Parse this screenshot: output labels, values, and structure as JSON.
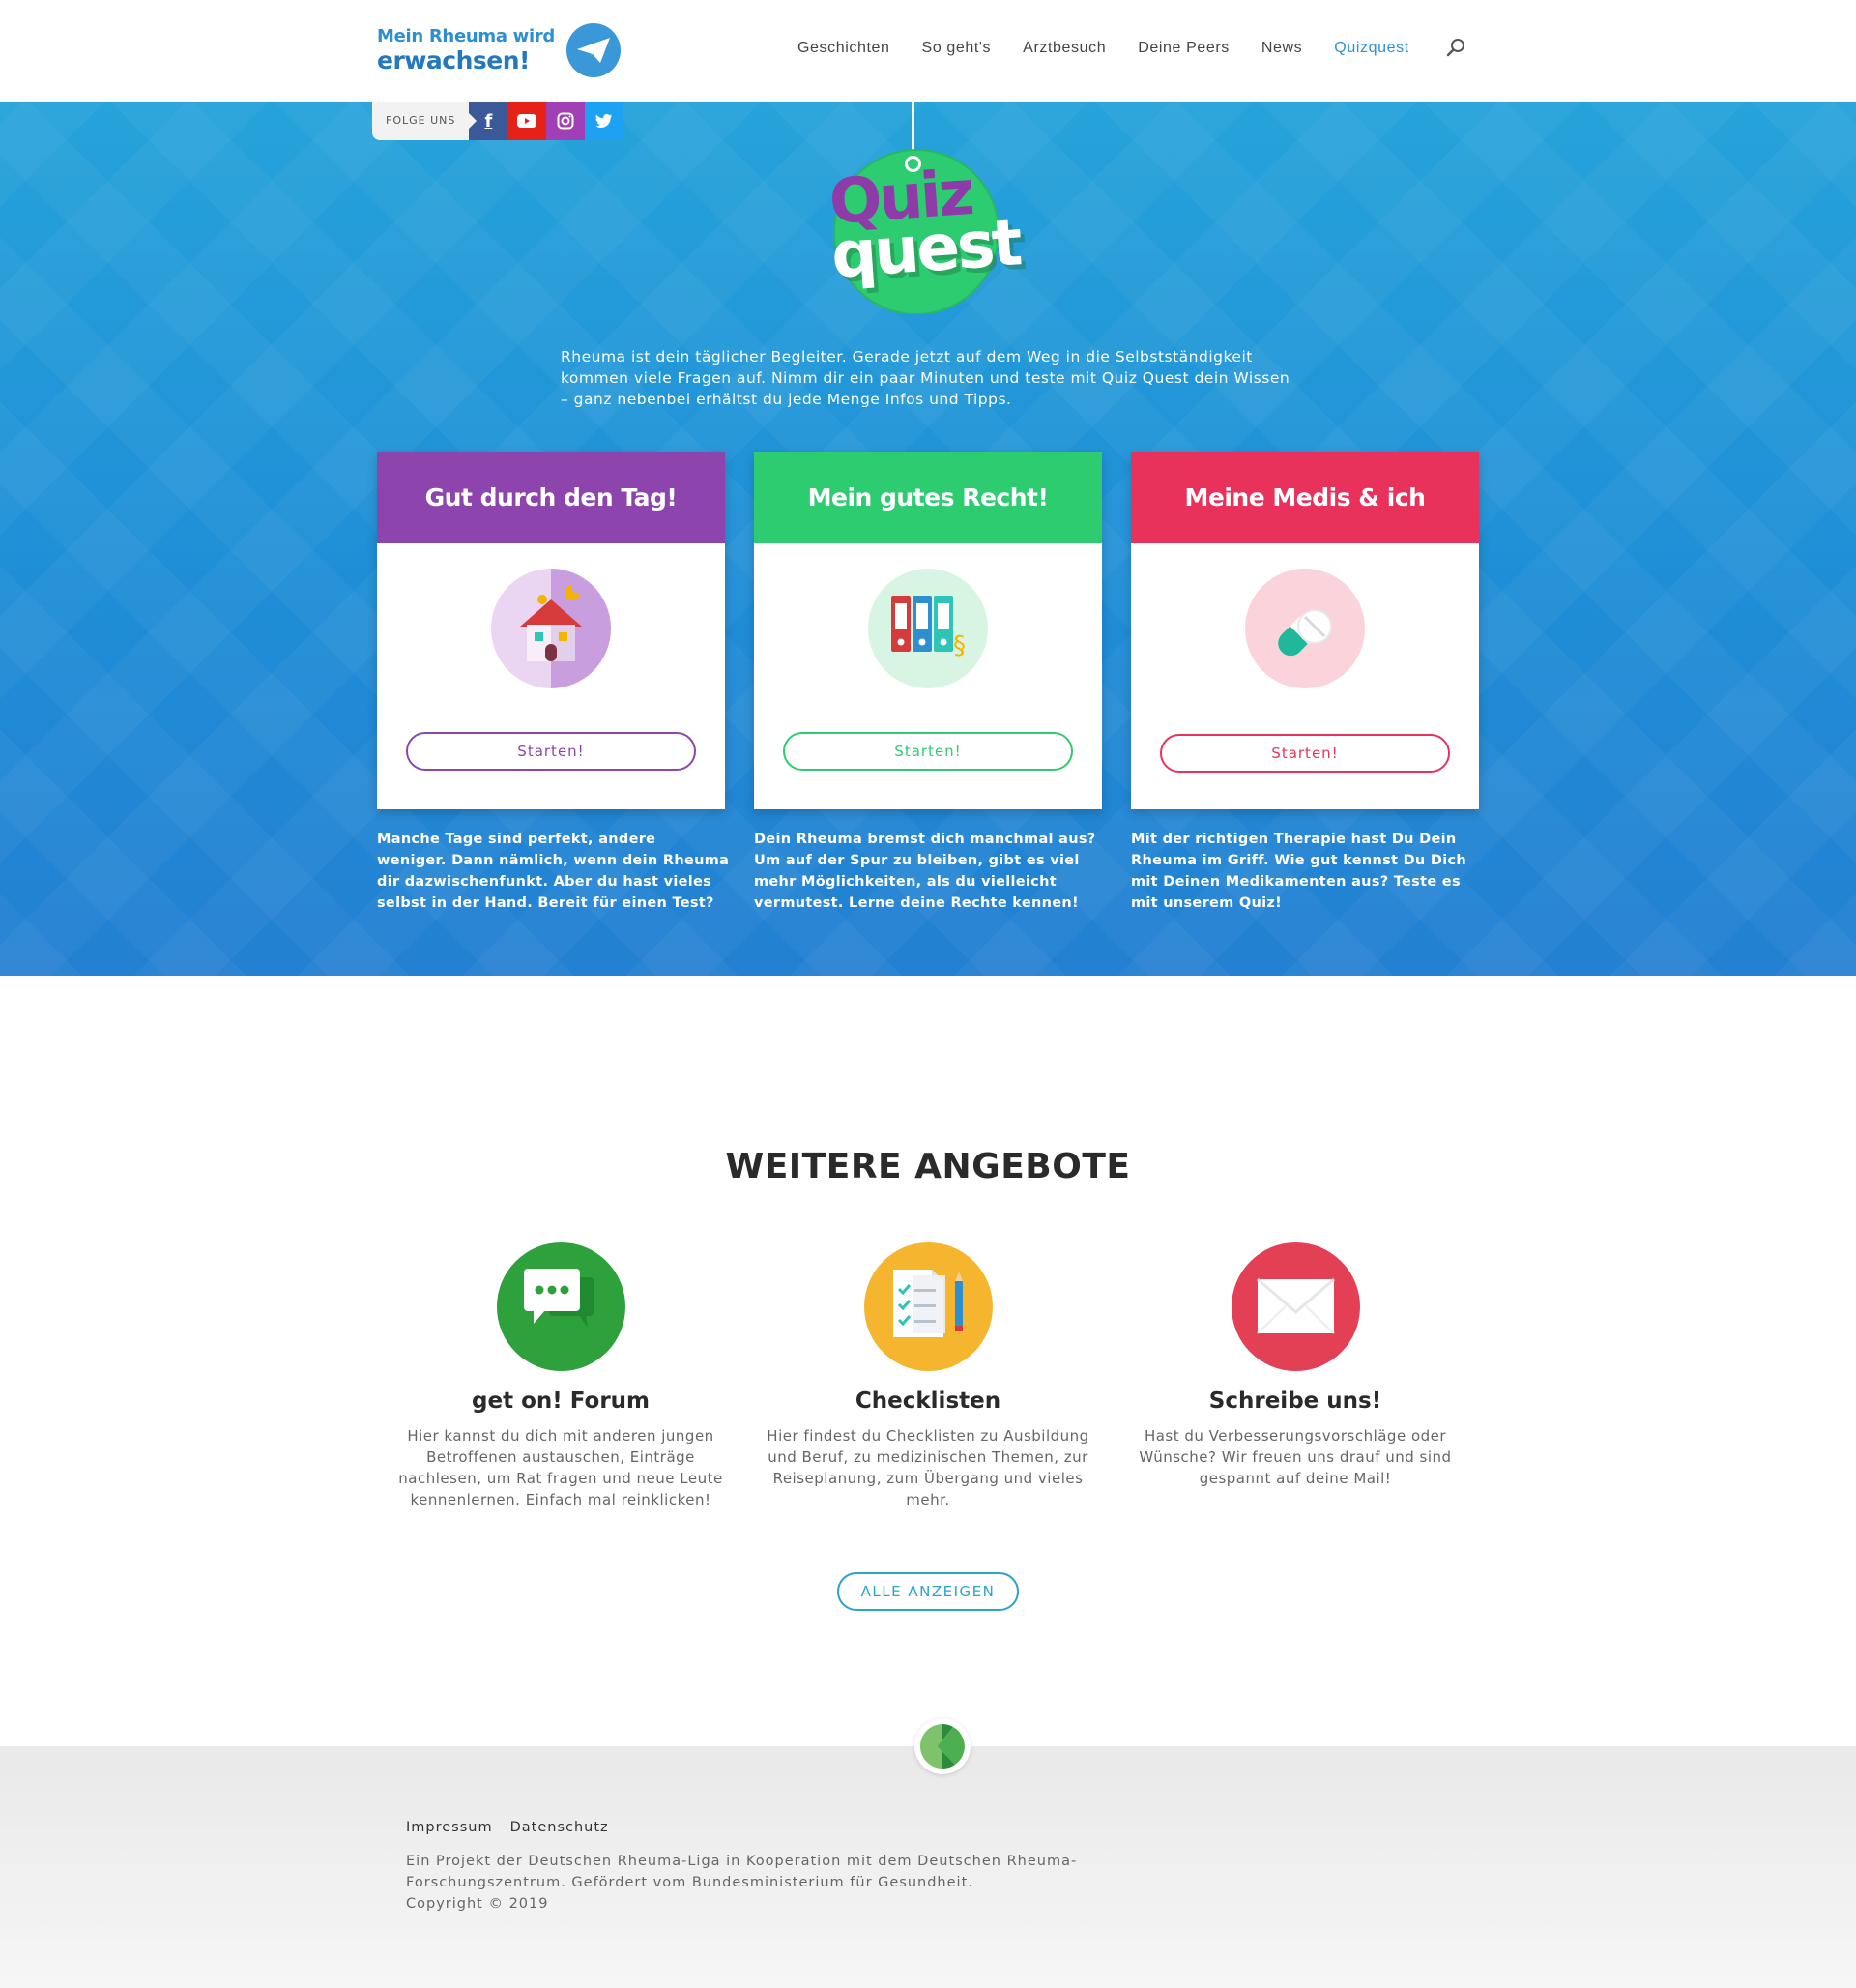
{
  "header": {
    "logo_line1": "Mein Rheuma wird",
    "logo_line2": "erwachsen!",
    "nav": [
      "Geschichten",
      "So geht's",
      "Arztbesuch",
      "Deine Peers",
      "News",
      "Quizquest"
    ],
    "active_nav": "Quizquest"
  },
  "hero": {
    "follow_label": "FOLGE UNS",
    "social": [
      "facebook-icon",
      "youtube-icon",
      "instagram-icon",
      "twitter-icon"
    ],
    "badge_line1": "Quiz",
    "badge_line2": "quest",
    "intro": "Rheuma ist dein täglicher Begleiter. Gerade jetzt auf dem Weg in die Selbstständigkeit kommen viele Fragen auf. Nimm dir ein paar Minuten und teste mit Quiz Quest dein Wissen – ganz nebenbei erhältst du jede Menge Infos und Tipps.",
    "cards": [
      {
        "title": "Gut durch den Tag!",
        "button": "Starten!",
        "color": "#8e44ad",
        "icon": "house-icon",
        "description": "Manche Tage sind perfekt, andere weniger. Dann nämlich, wenn dein Rheuma dir dazwischenfunkt. Aber du hast vieles selbst in der Hand. Bereit für einen Test?"
      },
      {
        "title": "Mein gutes Recht!",
        "button": "Starten!",
        "color": "#2ecc71",
        "icon": "folders-icon",
        "description": "Dein Rheuma bremst dich manchmal aus? Um auf der Spur zu bleiben, gibt es viel mehr Möglichkeiten, als du vielleicht vermutest. Lerne deine Rechte kennen!"
      },
      {
        "title": "Meine Medis & ich",
        "button": "Starten!",
        "color": "#e8315b",
        "icon": "pill-icon",
        "description": "Mit der richtigen Therapie hast Du Dein Rheuma im Griff. Wie gut kennst Du Dich mit Deinen Medikamenten aus? Teste es mit unserem Quiz!"
      }
    ]
  },
  "offers": {
    "title": "WEITERE ANGEBOTE",
    "items": [
      {
        "title": "get on! Forum",
        "icon": "chat-icon",
        "color": "#2ea03c",
        "description": "Hier kannst du dich mit anderen jungen Betroffenen austauschen, Einträge nachlesen, um Rat fragen und neue Leute kennenlernen. Einfach mal reinklicken!"
      },
      {
        "title": "Checklisten",
        "icon": "checklist-icon",
        "color": "#f6b52f",
        "description": "Hier findest du Checklisten zu Ausbildung und Beruf, zu medizinischen Themen, zur Reiseplanung, zum Übergang und vieles mehr."
      },
      {
        "title": "Schreibe uns!",
        "icon": "mail-icon",
        "color": "#e34055",
        "description": "Hast du Verbesserungsvorschläge oder Wünsche? Wir freuen uns drauf und sind gespannt auf deine Mail!"
      }
    ],
    "all_button": "ALLE ANZEIGEN"
  },
  "footer": {
    "links": [
      "Impressum",
      "Datenschutz"
    ],
    "text": "Ein Projekt der Deutschen Rheuma-Liga in Kooperation mit dem Deutschen Rheuma-Forschungszentrum. Gefördert vom Bundesministerium für Gesundheit.",
    "copyright": "Copyright © 2019"
  }
}
